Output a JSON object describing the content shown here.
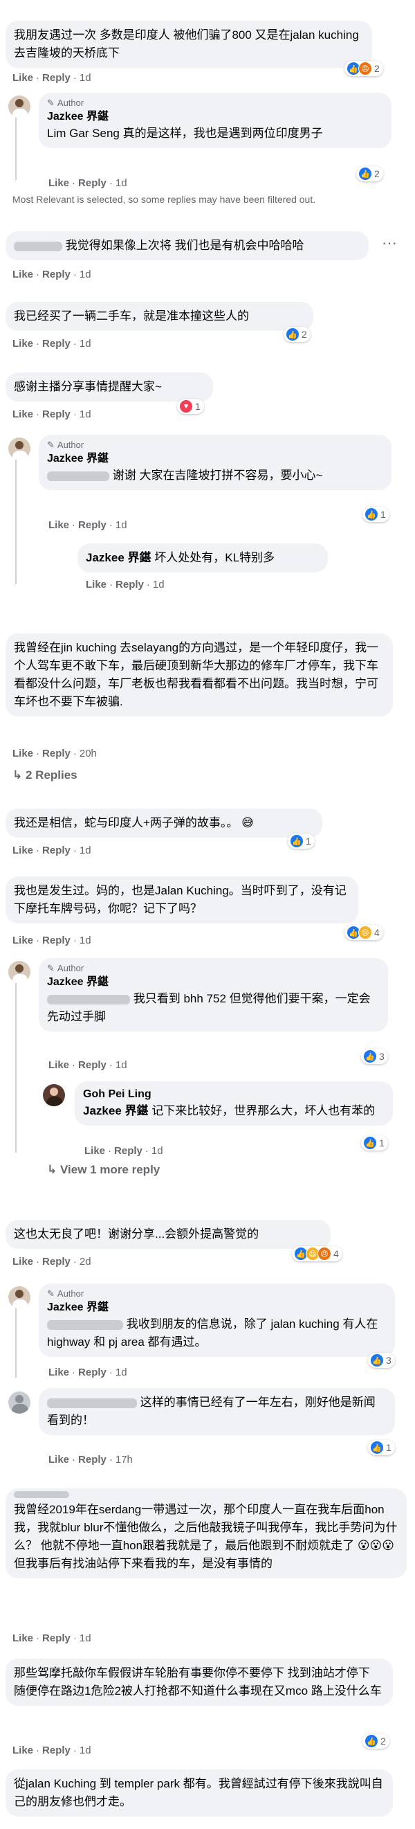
{
  "ui": {
    "like": "Like",
    "reply": "Reply",
    "sep": "·",
    "author": "Author"
  },
  "c1": {
    "text": "我朋友遇过一次 多数是印度人 被他们骗了800 又是在jalan kuching 去吉隆坡的天桥底下",
    "time": "1d",
    "rc": "2"
  },
  "c1r1": {
    "name": "Jazkee 界鍖",
    "text": "Lim Gar Seng 真的是这样，我也是遇到两位印度男子",
    "time": "1d",
    "rc": "2"
  },
  "filter_note": "Most Relevant is selected, so some replies may have been filtered out.",
  "c2": {
    "text": "我觉得如果像上次将 我们也是有机会中哈哈哈",
    "time": "1d",
    "menu": "···"
  },
  "c3": {
    "text": "我已经买了一辆二手车，就是准本撞这些人的",
    "time": "1d",
    "rc": "2"
  },
  "c4": {
    "text": "感谢主播分享事情提醒大家~",
    "time": "1d",
    "rc": "1"
  },
  "c4r1": {
    "name": "Jazkee 界鍖",
    "text": "谢谢 大家在吉隆坡打拼不容易，要小心~",
    "time": "1d",
    "rc": "1"
  },
  "c4r2": {
    "name": "Jazkee 界鍖",
    "text": "坏人处处有，KL特别多",
    "time": "1d"
  },
  "c5": {
    "text": "我曾经在jin kuching 去selayang的方向遇过，是一个年轻印度仔，我一个人驾车更不敢下车，最后硬顶到新华大那边的修车厂才停车，我下车看都没什么问题，车厂老板也帮我看看都看不出问题。我当时想，宁可车坏也不要下车被骗.",
    "time": "20h",
    "replies": "2 Replies"
  },
  "c6": {
    "text": "我还是相信，蛇与印度人+两子弹的故事。。",
    "emoji": "😅",
    "time": "1d",
    "rc": "1"
  },
  "c7": {
    "text": "我也是发生过。妈的，也是Jalan Kuching。当时吓到了，没有记下摩托车牌号码，你呢？记下了吗？",
    "time": "1d",
    "rc": "4"
  },
  "c7r1": {
    "name": "Jazkee 界鍖",
    "text": "我只看到 bhh 752 但觉得他们要干案，一定会先动过手脚",
    "time": "1d",
    "rc": "3"
  },
  "c7r2": {
    "name": "Goh Pei Ling",
    "mention": "Jazkee 界鍖",
    "text": " 记下来比较好，世界那么大，坏人也有苯的",
    "time": "1d",
    "rc": "1"
  },
  "c7more": "View 1 more reply",
  "c8": {
    "text": "这也太无良了吧！谢谢分享...会额外提高警觉的",
    "time": "2d",
    "rc": "4"
  },
  "c8r1": {
    "name": "Jazkee 界鍖",
    "text": "我收到朋友的信息说，除了 jalan kuching 有人在highway 和 pj area 都有遇过。",
    "time": "1d",
    "rc": "3"
  },
  "c9": {
    "text": "这样的事情已经有了一年左右，刚好他是新闻看到的！",
    "time": "17h",
    "rc": "1"
  },
  "c10": {
    "text1": "我曾经2019年在serdang一带遇过一次，那个印度人一直在我车后面hon 我，我就blur blur不懂他做么，之后他敲我镜子叫我停车，我比手势问为什么？ 他就不停地一直hon跟着我就是了，最后他跟到不耐烦就走了",
    "emoji1": "😮😮😮",
    "text2": "但我事后有找油站停下来看我的车，是没有事情的",
    "time": "1d"
  },
  "c11": {
    "text": "那些驾摩托敲你车假假讲车轮胎有事要你停不要停下 找到油站才停下 随便停在路边1危险2被人打抢都不知道什么事现在又mco 路上没什么车",
    "time": "1d",
    "rc": "2"
  },
  "c12": {
    "text": "從jalan Kuching 到 templer park 都有。我曾經試过有停下後來我說叫自己的朋友修也們才走。"
  }
}
